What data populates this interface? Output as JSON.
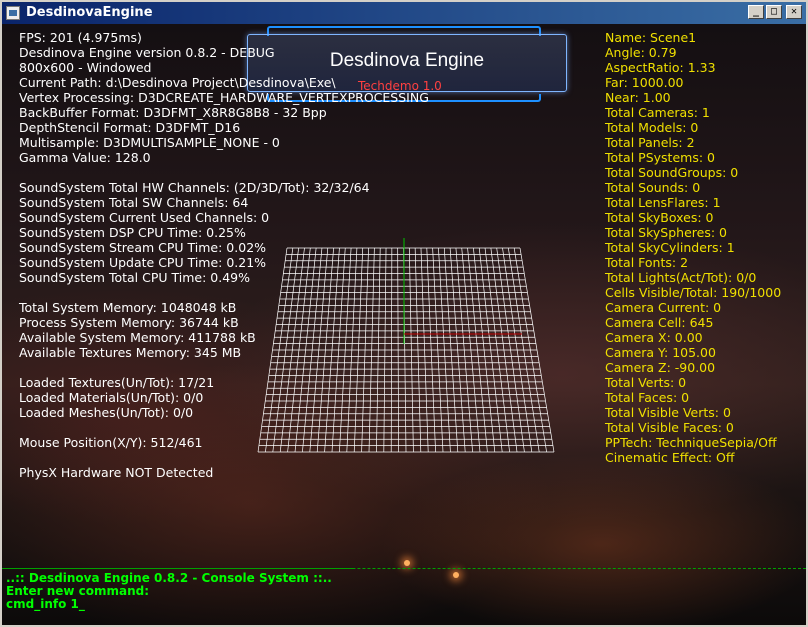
{
  "window": {
    "title": "DesdinovaEngine",
    "buttons": {
      "minimize": "_",
      "maximize": "□",
      "close": "✕"
    }
  },
  "banner": {
    "title": "Desdinova Engine",
    "subtitle": "Techdemo 1.0"
  },
  "left_stats": [
    "FPS: 201 (4.975ms)",
    "Desdinova Engine version 0.8.2 - DEBUG",
    "800x600 - Windowed",
    "Current Path: d:\\Desdinova Project\\Desdinova\\Exe\\",
    "Vertex Processing: D3DCREATE_HARDWARE_VERTEXPROCESSING",
    "BackBuffer Format: D3DFMT_X8R8G8B8 - 32 Bpp",
    "DepthStencil Format: D3DFMT_D16",
    "Multisample: D3DMULTISAMPLE_NONE - 0",
    "Gamma Value: 128.0",
    "",
    "SoundSystem Total HW Channels: (2D/3D/Tot): 32/32/64",
    "SoundSystem Total SW Channels: 64",
    "SoundSystem Current Used Channels: 0",
    "SoundSystem DSP CPU Time: 0.25%",
    "SoundSystem Stream CPU Time: 0.02%",
    "SoundSystem Update CPU Time: 0.21%",
    "SoundSystem Total CPU Time: 0.49%",
    "",
    "Total System Memory: 1048048 kB",
    "Process System Memory: 36744 kB",
    "Available System Memory: 411788 kB",
    "Available Textures Memory: 345 MB",
    "",
    "Loaded Textures(Un/Tot): 17/21",
    "Loaded Materials(Un/Tot): 0/0",
    "Loaded Meshes(Un/Tot): 0/0",
    "",
    "Mouse Position(X/Y): 512/461",
    "",
    "PhysX Hardware NOT Detected"
  ],
  "right_stats": [
    "Name: Scene1",
    "Angle: 0.79",
    "AspectRatio: 1.33",
    "Far: 1000.00",
    "Near: 1.00",
    "Total Cameras: 1",
    "Total Models: 0",
    "Total Panels: 2",
    "Total PSystems: 0",
    "Total SoundGroups: 0",
    "Total Sounds: 0",
    "Total LensFlares: 1",
    "Total SkyBoxes: 0",
    "Total SkySpheres: 0",
    "Total SkyCylinders: 1",
    "Total Fonts: 2",
    "Total Lights(Act/Tot): 0/0",
    "Cells Visible/Total: 190/1000",
    "Camera Current: 0",
    "Camera Cell: 645",
    "Camera X: 0.00",
    "Camera Y: 105.00",
    "Camera Z: -90.00",
    "Total Verts: 0",
    "Total Faces: 0",
    "Total Visible Verts: 0",
    "Total Visible Faces: 0",
    "PPTech: TechniqueSepia/Off",
    "Cinematic Effect: Off"
  ],
  "console": {
    "header": "..:: Desdinova Engine 0.8.2 - Console System ::..",
    "prompt": "Enter new command:",
    "input": "cmd_info 1_"
  },
  "colors": {
    "right_text": "#f0e000",
    "console_text": "#00ff00",
    "banner_border": "#1e90ff",
    "subtitle": "#ff4040"
  }
}
